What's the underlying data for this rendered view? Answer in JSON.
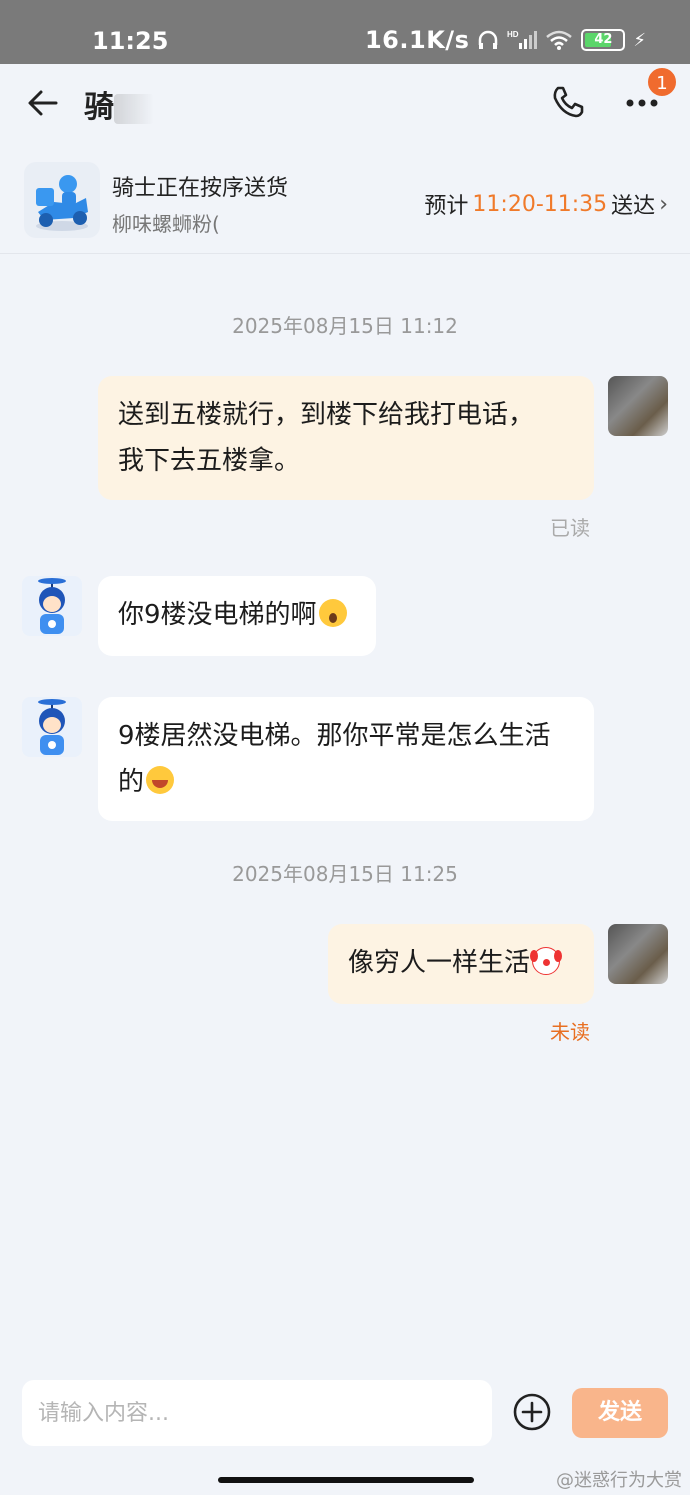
{
  "status_bar": {
    "time": "11:25",
    "network_speed": "16.1K/s",
    "battery": "42"
  },
  "header": {
    "title": "骑",
    "notification_count": "1"
  },
  "order": {
    "status": "骑士正在按序送货",
    "shop": "柳味螺蛳粉(",
    "eta_prefix": "预计",
    "eta_time": "11:20-11:35",
    "eta_suffix": "送达"
  },
  "messages": {
    "timestamp_1": "2025年08月15日 11:12",
    "msg_1_line1": "送到五楼就行，到楼下给我打电话，",
    "msg_1_line2": "我下去五楼拿。",
    "msg_1_status": "已读",
    "msg_2": "你9楼没电梯的啊",
    "msg_3_line1": "9楼居然没电梯。那你平常是怎么生活",
    "msg_3_line2": "的",
    "timestamp_2": "2025年08月15日 11:25",
    "msg_4": "像穷人一样生活",
    "msg_4_status": "未读"
  },
  "input": {
    "placeholder": "请输入内容...",
    "send_label": "发送"
  },
  "watermark": "@迷惑行为大赏",
  "colors": {
    "accent": "#f07a2a",
    "my_bubble": "#fdf3e3",
    "send_button": "#f9b58b"
  }
}
